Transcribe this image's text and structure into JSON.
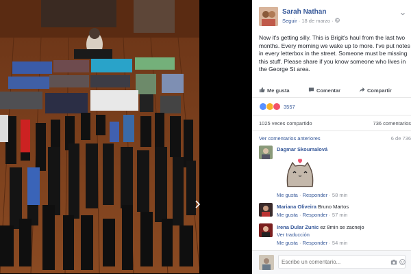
{
  "post": {
    "author": "Sarah Nathan",
    "follow": "Seguir",
    "date": "18 de marzo",
    "text": "Now it's getting silly. This is Brigit's haul from the last two months. Every morning we wake up to more. I've put notes in every letterbox in the street. Someone must be missing this stuff. Please share if you know someone who lives in the George St area."
  },
  "actions": {
    "like": "Me gusta",
    "comment": "Comentar",
    "share": "Compartir"
  },
  "stats": {
    "reactions": "3557",
    "shares": "1025 veces compartido",
    "comments": "736 comentarios"
  },
  "comments_section": {
    "previous_label": "Ver comentarios anteriores",
    "count": "6 de 736"
  },
  "comments": [
    {
      "author": "Dagmar Skoumalová",
      "text": "",
      "like": "Me gusta",
      "reply": "Responder",
      "time": "58 min"
    },
    {
      "author": "Mariana Oliveira",
      "text": "Bruno Martos",
      "like": "Me gusta",
      "reply": "Responder",
      "time": "57 min"
    },
    {
      "author": "Irena Dular Zunic",
      "text": "ez 8min se zacnejo",
      "translate": "Ver traducción",
      "like": "Me gusta",
      "reply": "Responder",
      "time": "54 min"
    }
  ],
  "composer": {
    "placeholder": "Escribe un comentario..."
  },
  "colors": {
    "link": "#365899",
    "floor": "#7a3f1e",
    "like_blue": "#5890ff",
    "love_red": "#f25268"
  },
  "icons": [
    "globe-icon",
    "more-icon",
    "like-thumb-icon",
    "comment-bubble-icon",
    "share-arrow-icon",
    "camera-icon",
    "smiley-icon",
    "next-arrow-icon"
  ]
}
